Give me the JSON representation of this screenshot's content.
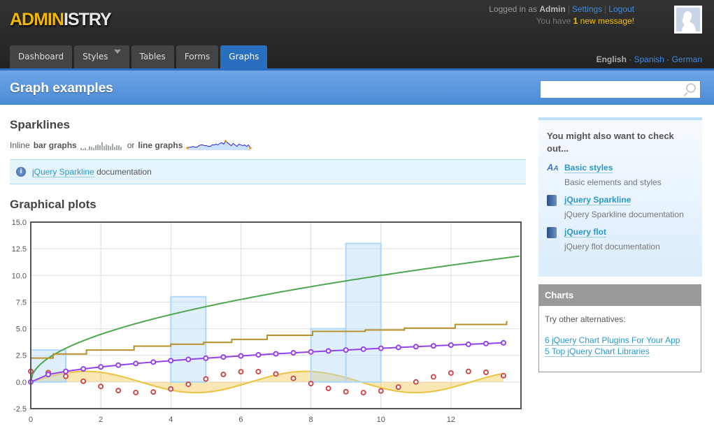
{
  "header": {
    "logo_part1": "ADMIN",
    "logo_part2": "ISTRY",
    "logged_in_as": "Logged in as",
    "user": "Admin",
    "settings": "Settings",
    "logout": "Logout",
    "msg_prefix": "You have",
    "msg_count": "1",
    "msg_suffix": "new message!"
  },
  "nav": {
    "tabs": [
      {
        "label": "Dashboard"
      },
      {
        "label": "Styles"
      },
      {
        "label": "Tables"
      },
      {
        "label": "Forms"
      },
      {
        "label": "Graphs",
        "active": true
      }
    ]
  },
  "languages": {
    "current": "English",
    "others": [
      "Spanish",
      "German"
    ]
  },
  "page": {
    "title": "Graph examples",
    "search": {
      "value": "",
      "placeholder": ""
    }
  },
  "sparklines": {
    "heading": "Sparklines",
    "text1": "Inline",
    "bold1": "bar graphs",
    "text2": "or",
    "bold2": "line graphs",
    "bar_values": [
      2,
      1,
      2,
      0,
      4,
      3,
      2,
      5,
      6,
      5,
      9,
      4,
      6,
      5,
      4,
      7,
      3,
      5,
      5,
      3
    ],
    "line_values": [
      2,
      3,
      3,
      4,
      3,
      3,
      5,
      6,
      6,
      5,
      5,
      4,
      4,
      6,
      6,
      7,
      6,
      8,
      9,
      7,
      11,
      9,
      7,
      5,
      8,
      6,
      4,
      7,
      6,
      5,
      6,
      4,
      6,
      2
    ],
    "colors": {
      "bar": "#a4aaa4",
      "line": "#2222ee",
      "spot": "#ff8800"
    }
  },
  "note": {
    "link": "jQuery Sparkline",
    "text": "documentation",
    "icon": "info-icon"
  },
  "plots": {
    "heading": "Graphical plots"
  },
  "chart_data": {
    "type": "line",
    "xlim": [
      0,
      14
    ],
    "ylim": [
      -2.5,
      15
    ],
    "xticks": [
      "0",
      "2",
      "4",
      "6",
      "8",
      "10",
      "12"
    ],
    "yticks": [
      "-2.5",
      "0.0",
      "2.5",
      "5.0",
      "7.5",
      "10.0",
      "12.5",
      "15.0"
    ],
    "grid": true,
    "series": [
      {
        "kind": "area",
        "function": "sin(x)",
        "x_step": 0.5,
        "x_end": 13.5,
        "color": "#edc240"
      },
      {
        "kind": "bar",
        "color": "#afd8f8",
        "bar_width": 1,
        "points": [
          [
            0,
            3
          ],
          [
            4,
            8
          ],
          [
            8,
            5
          ],
          [
            9,
            13
          ]
        ]
      },
      {
        "kind": "line",
        "function": "sqrt(10x)",
        "x_step": 0.5,
        "x_end": 14,
        "color": "#4da74d"
      },
      {
        "kind": "points",
        "function": "cos(x)",
        "x_step": 0.5,
        "x_end": 13.5,
        "color": "#cb4b4b"
      },
      {
        "kind": "steps",
        "color": "#b8902a",
        "points": [
          [
            0,
            2.24
          ],
          [
            0.64,
            2.63
          ],
          [
            1.59,
            3.0
          ],
          [
            2.95,
            3.37
          ],
          [
            4.0,
            3.55
          ],
          [
            4.94,
            3.72
          ],
          [
            5.74,
            4.0
          ],
          [
            6.75,
            4.38
          ],
          [
            8.05,
            4.75
          ],
          [
            9.55,
            4.88
          ],
          [
            10.67,
            5.05
          ],
          [
            12.12,
            5.4
          ],
          [
            13.59,
            5.73
          ]
        ]
      },
      {
        "kind": "line-points",
        "function": "sqrt(x)",
        "x_step": 0.5,
        "x_end": 13.5,
        "color": "#9440ed"
      }
    ]
  },
  "sidebar": {
    "heading": "You might also want to check out...",
    "items": [
      {
        "title": "Basic styles",
        "desc": "Basic elements and styles",
        "icon": "font-icon"
      },
      {
        "title": "jQuery Sparkline",
        "desc": "jQuery Sparkline documentation",
        "icon": "book-icon"
      },
      {
        "title": "jQuery flot",
        "desc": "jQuery flot documentation",
        "icon": "book-icon"
      }
    ]
  },
  "charts_box": {
    "heading": "Charts",
    "intro": "Try other alternatives:",
    "links": [
      "6 jQuery Chart Plugins For Your App",
      "5 Top jQuery Chart Libraries"
    ]
  }
}
